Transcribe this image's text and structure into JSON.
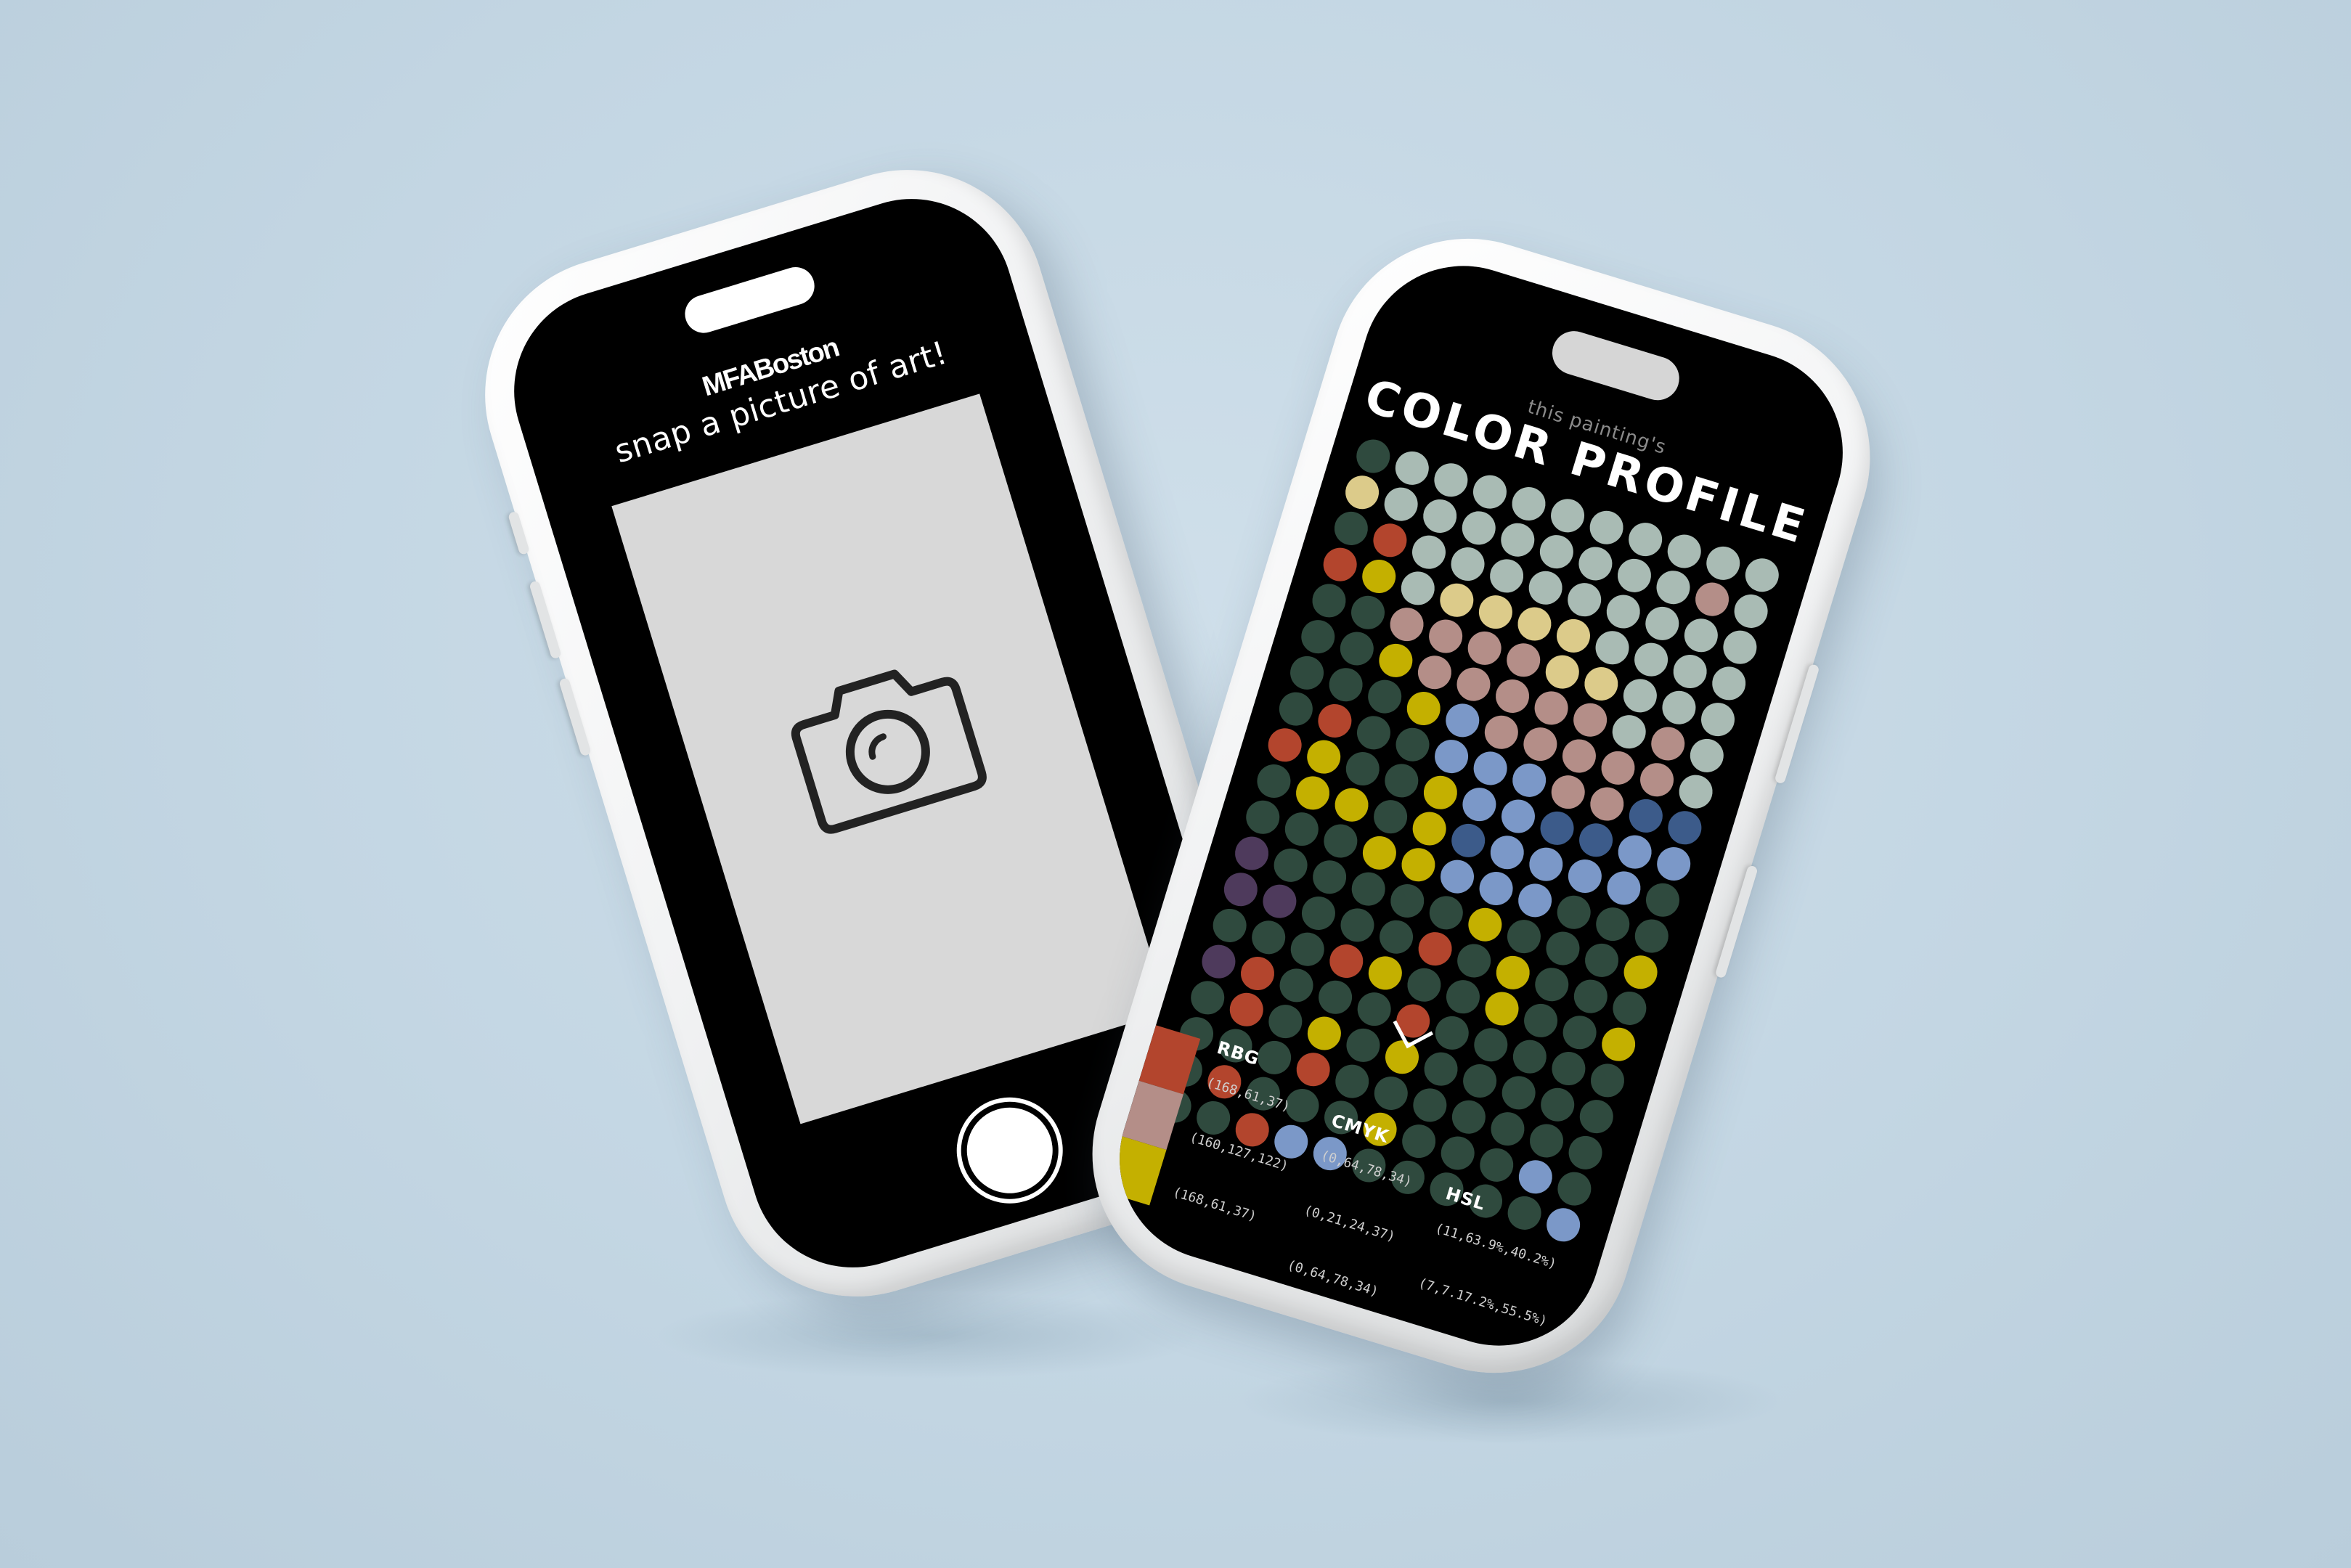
{
  "left_phone": {
    "logo": "MFABoston",
    "title": "snap a picture of art!",
    "viewfinder_icon": "camera-icon",
    "shutter_icon": "shutter-button-icon"
  },
  "right_phone": {
    "subtitle": "this painting's",
    "title": "COLOR PROFILE",
    "scroll_icon": "chevron-down-icon",
    "palette": {
      "G": "#2f4a3e",
      "L": "#a9bbb4",
      "R": "#b3452d",
      "Y": "#c4b000",
      "P": "#b48e88",
      "B": "#7b98c8",
      "N": "#3c5b8a",
      "C": "#dccb8a",
      "V": "#4e3a5c"
    },
    "dot_rows": [
      "GLLLLLLLLLL",
      "CLLLLLLLLPL",
      "GRLLLLLLLLL",
      "RYLCCCCLLLL",
      "GGPPPPCCLLL",
      "GGYPPPPPLPL",
      "GGGYBPPPPPL",
      "GRGGBBBPPNN",
      "RYGGYBBNNBB",
      "GYYGYNBBBBG",
      "GGGYYBBBGGG",
      "VGGGGGYGGGY",
      "VVGGGRGYGGG",
      "GGGRYGGYGGY",
      "VRGGGRGGGGG",
      "GRGYGYGGGGG",
      "GGGRGGGGGGG",
      "GRGGGYGGGBG",
      "GGRBBGGGGGB"
    ],
    "swatches": [
      "#b3452d",
      "#b48e88",
      "#c4b000"
    ],
    "table": {
      "headers": [
        "RBG",
        "CMYK",
        "HSL"
      ],
      "rows": [
        [
          "(168,61,37)",
          "(0,64,78,34)",
          "(11,63.9%,40.2%)"
        ],
        [
          "(160,127,122)",
          "(0,21,24,37)",
          "(7,7.17.2%,55.5%)"
        ],
        [
          "(168,61,37)",
          "(0,64,78,34)",
          "(11,63.9%,40.2%)"
        ]
      ]
    }
  }
}
